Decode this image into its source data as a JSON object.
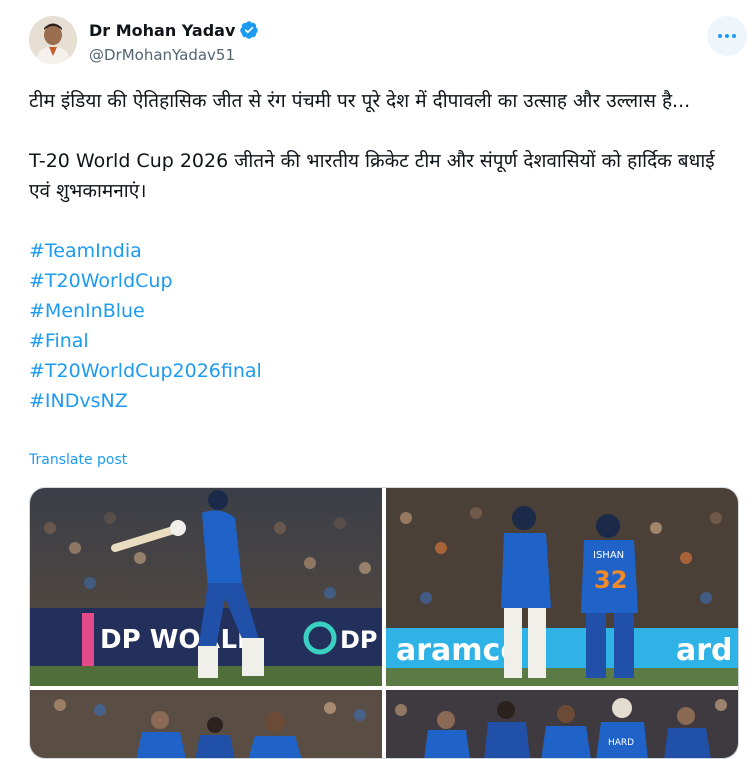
{
  "author": {
    "name": "Dr Mohan Yadav",
    "handle": "@DrMohanYadav51",
    "verified": true
  },
  "tweet": {
    "paragraph1": "टीम इंडिया की ऐतिहासिक जीत से रंग पंचमी पर पूरे देश में दीपावली का उत्साह और उल्लास है...",
    "paragraph2": "T-20 World Cup 2026 जीतने की भारतीय क्रिकेट टीम और संपूर्ण देशवासियों को हार्दिक बधाई एवं शुभकामनाएं।",
    "hashtags": [
      "#TeamIndia",
      "#T20WorldCup",
      "#MenInBlue",
      "#Final",
      "#T20WorldCup2026final",
      "#INDvsNZ"
    ]
  },
  "translate_label": "Translate post",
  "media": {
    "photo1_banner": "DP WORLD",
    "photo1_banner_right": "DP",
    "photo2_jersey_name": "ISHAN",
    "photo2_jersey_number": "32",
    "photo2_banner": "aramco",
    "photo2_banner_right": "ard",
    "photo4_jersey_name": "HARD"
  },
  "colors": {
    "link": "#1d9bf0",
    "secondary_text": "#536471",
    "india_blue": "#1f63c9"
  },
  "icons": {
    "verified": "verified-badge-icon",
    "more": "more-options-icon"
  }
}
